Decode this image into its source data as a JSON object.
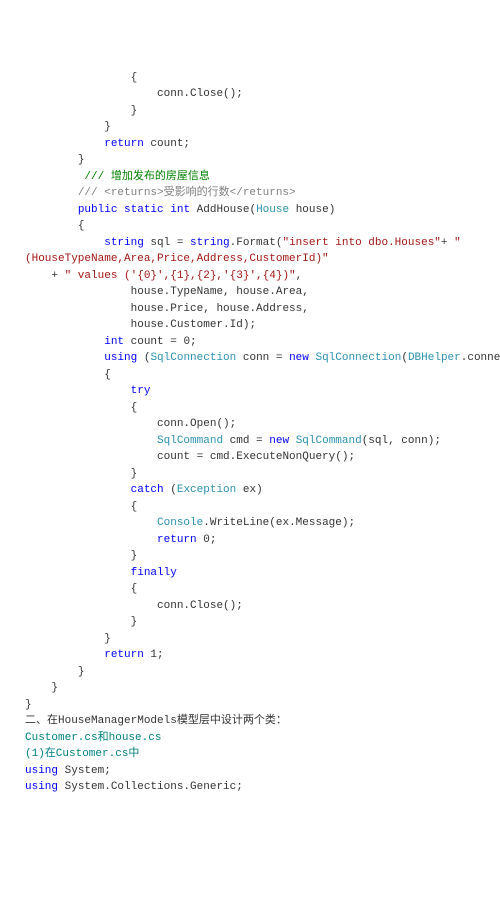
{
  "lines": [
    {
      "indent": 16,
      "spans": [
        {
          "t": "{"
        }
      ]
    },
    {
      "indent": 20,
      "spans": [
        {
          "t": "conn.Close();"
        }
      ]
    },
    {
      "indent": 16,
      "spans": [
        {
          "t": "}"
        }
      ]
    },
    {
      "indent": 12,
      "spans": [
        {
          "t": "}"
        }
      ]
    },
    {
      "indent": 12,
      "spans": [
        {
          "t": "return",
          "c": "kw"
        },
        {
          "t": " count;"
        }
      ]
    },
    {
      "indent": 8,
      "spans": [
        {
          "t": "}"
        }
      ]
    },
    {
      "indent": 8,
      "spans": [
        {
          "t": " /// 增加发布的房屋信息",
          "c": "cmt-g"
        }
      ]
    },
    {
      "indent": 8,
      "spans": [
        {
          "t": "/// <returns>受影响的行数</returns>",
          "c": "cmt-grey"
        }
      ]
    },
    {
      "indent": 8,
      "spans": [
        {
          "t": "public",
          "c": "kw"
        },
        {
          "t": " "
        },
        {
          "t": "static",
          "c": "kw"
        },
        {
          "t": " "
        },
        {
          "t": "int",
          "c": "kw"
        },
        {
          "t": " AddHouse("
        },
        {
          "t": "House",
          "c": "type"
        },
        {
          "t": " house)"
        }
      ]
    },
    {
      "indent": 8,
      "spans": [
        {
          "t": "{"
        }
      ]
    },
    {
      "indent": 12,
      "spans": [
        {
          "t": "string",
          "c": "kw"
        },
        {
          "t": " sql = "
        },
        {
          "t": "string",
          "c": "kw"
        },
        {
          "t": ".Format("
        },
        {
          "t": "\"insert into dbo.Houses\"",
          "c": "str"
        },
        {
          "t": "+ "
        },
        {
          "t": "\"",
          "c": "str"
        }
      ]
    },
    {
      "indent": 0,
      "spans": [
        {
          "t": "(HouseTypeName,Area,Price,Address,CustomerId)\"",
          "c": "str"
        }
      ]
    },
    {
      "indent": 4,
      "spans": [
        {
          "t": "+ "
        },
        {
          "t": "\" values ('{0}',{1},{2},'{3}',{4})\"",
          "c": "str"
        },
        {
          "t": ","
        }
      ]
    },
    {
      "indent": 16,
      "spans": [
        {
          "t": "house.TypeName, house.Area,"
        }
      ]
    },
    {
      "indent": 16,
      "spans": [
        {
          "t": "house.Price, house.Address,"
        }
      ]
    },
    {
      "indent": 16,
      "spans": [
        {
          "t": "house.Customer.Id);"
        }
      ]
    },
    {
      "indent": 12,
      "spans": [
        {
          "t": "int",
          "c": "kw"
        },
        {
          "t": " count = 0;"
        }
      ]
    },
    {
      "indent": 12,
      "spans": [
        {
          "t": "using",
          "c": "kw"
        },
        {
          "t": " ("
        },
        {
          "t": "SqlConnection",
          "c": "type"
        },
        {
          "t": " conn = "
        },
        {
          "t": "new",
          "c": "kw"
        },
        {
          "t": " "
        },
        {
          "t": "SqlConnection",
          "c": "type"
        },
        {
          "t": "("
        },
        {
          "t": "DBHelper",
          "c": "type"
        },
        {
          "t": ".connectString))"
        }
      ]
    },
    {
      "indent": 12,
      "spans": [
        {
          "t": "{"
        }
      ]
    },
    {
      "indent": 16,
      "spans": [
        {
          "t": "try",
          "c": "kw"
        }
      ]
    },
    {
      "indent": 16,
      "spans": [
        {
          "t": "{"
        }
      ]
    },
    {
      "indent": 20,
      "spans": [
        {
          "t": "conn.Open();"
        }
      ]
    },
    {
      "indent": 20,
      "spans": [
        {
          "t": "SqlCommand",
          "c": "type"
        },
        {
          "t": " cmd = "
        },
        {
          "t": "new",
          "c": "kw"
        },
        {
          "t": " "
        },
        {
          "t": "SqlCommand",
          "c": "type"
        },
        {
          "t": "(sql, conn);"
        }
      ]
    },
    {
      "indent": 20,
      "spans": [
        {
          "t": "count = cmd.ExecuteNonQuery();"
        }
      ]
    },
    {
      "indent": 16,
      "spans": [
        {
          "t": "}"
        }
      ]
    },
    {
      "indent": 16,
      "spans": [
        {
          "t": "catch",
          "c": "kw"
        },
        {
          "t": " ("
        },
        {
          "t": "Exception",
          "c": "type"
        },
        {
          "t": " ex)"
        }
      ]
    },
    {
      "indent": 16,
      "spans": [
        {
          "t": "{"
        }
      ]
    },
    {
      "indent": 20,
      "spans": [
        {
          "t": "Console",
          "c": "type"
        },
        {
          "t": ".WriteLine(ex.Message);"
        }
      ]
    },
    {
      "indent": 20,
      "spans": [
        {
          "t": "return",
          "c": "kw"
        },
        {
          "t": " 0;"
        }
      ]
    },
    {
      "indent": 16,
      "spans": [
        {
          "t": "}"
        }
      ]
    },
    {
      "indent": 16,
      "spans": [
        {
          "t": "finally",
          "c": "kw"
        }
      ]
    },
    {
      "indent": 16,
      "spans": [
        {
          "t": "{"
        }
      ]
    },
    {
      "indent": 20,
      "spans": [
        {
          "t": "conn.Close();"
        }
      ]
    },
    {
      "indent": 16,
      "spans": [
        {
          "t": "}"
        }
      ]
    },
    {
      "indent": 12,
      "spans": [
        {
          "t": "}"
        }
      ]
    },
    {
      "indent": 12,
      "spans": [
        {
          "t": "return",
          "c": "kw"
        },
        {
          "t": " 1;"
        }
      ]
    },
    {
      "indent": 8,
      "spans": [
        {
          "t": "}"
        }
      ]
    },
    {
      "indent": 4,
      "spans": [
        {
          "t": "}"
        }
      ]
    },
    {
      "indent": 0,
      "spans": [
        {
          "t": "}"
        }
      ]
    },
    {
      "indent": 0,
      "spans": [
        {
          "t": "二、在HouseManagerModels模型层中设计两个类：",
          "c": "prose"
        }
      ]
    },
    {
      "indent": 0,
      "spans": [
        {
          "t": "Customer.cs和house.cs",
          "c": "teal"
        }
      ]
    },
    {
      "indent": 0,
      "spans": [
        {
          "t": "(1)在Customer.cs中",
          "c": "teal"
        }
      ]
    },
    {
      "indent": 0,
      "spans": [
        {
          "t": "using",
          "c": "kw"
        },
        {
          "t": " System;"
        }
      ]
    },
    {
      "indent": 0,
      "spans": [
        {
          "t": "using",
          "c": "kw"
        },
        {
          "t": " System.Collections.Generic;"
        }
      ]
    }
  ]
}
